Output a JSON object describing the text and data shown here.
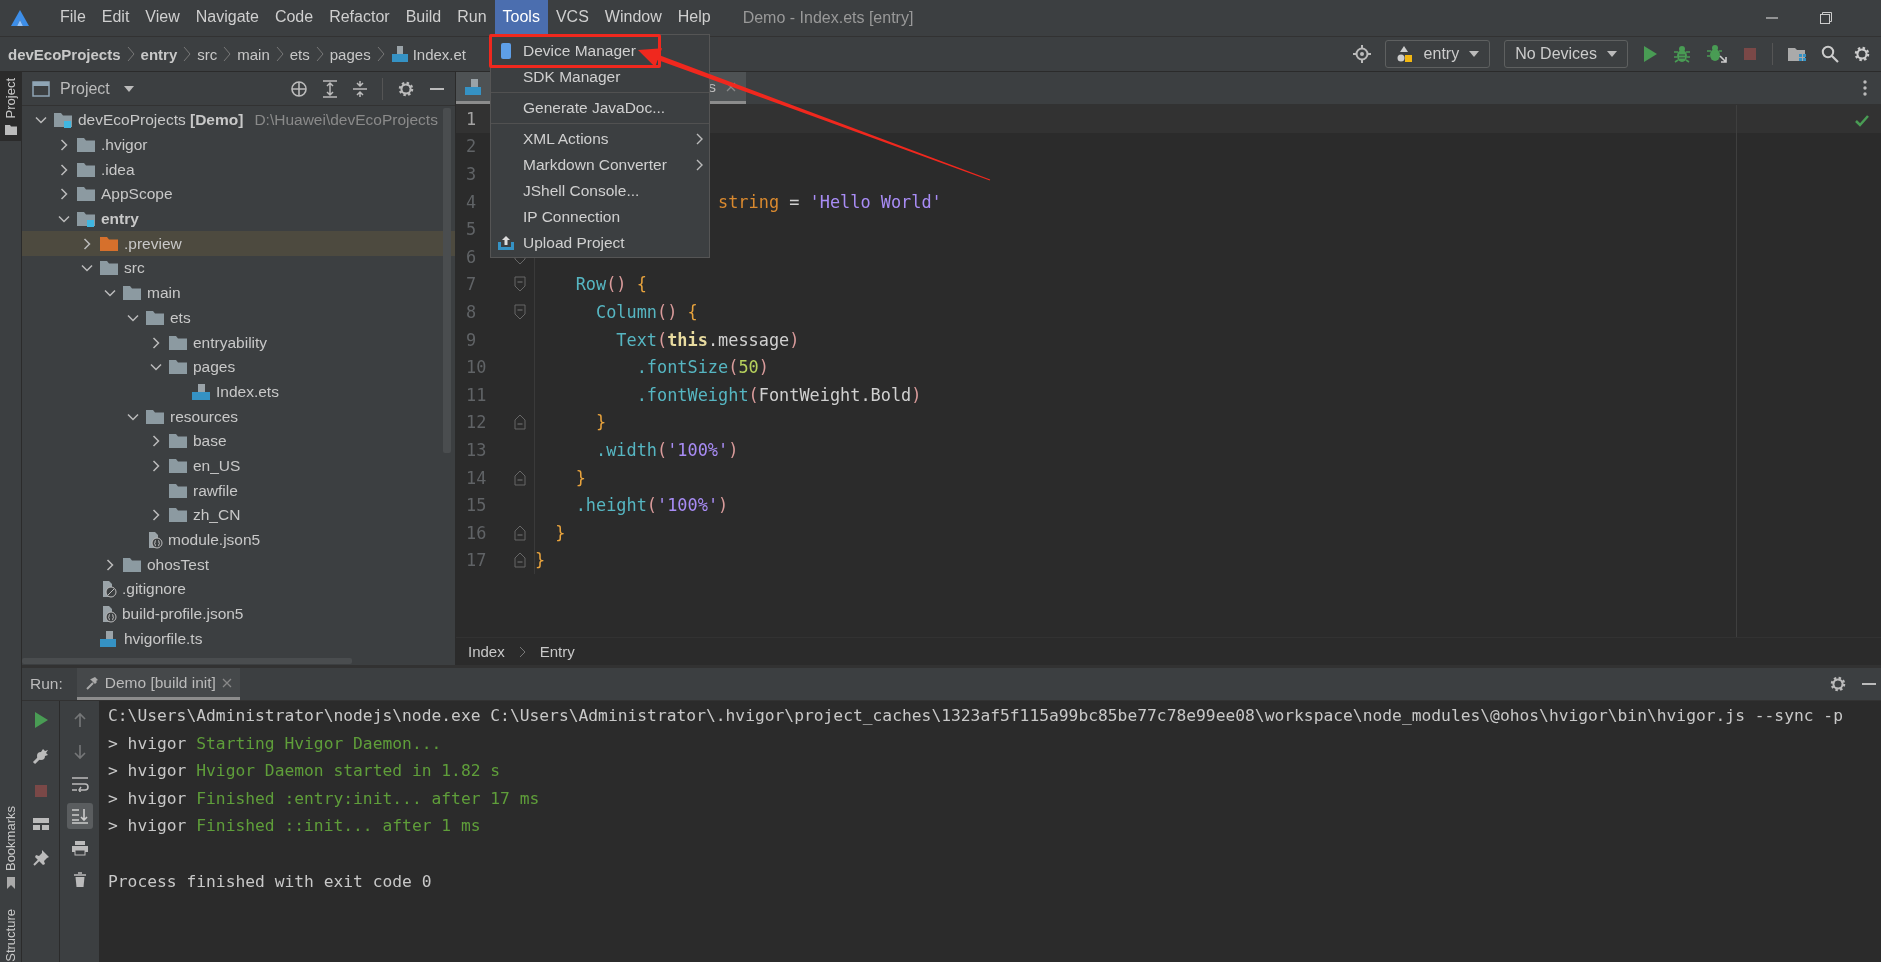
{
  "window": {
    "title": "Demo - Index.ets [entry]"
  },
  "menu_bar": [
    {
      "label": "File",
      "selected": false
    },
    {
      "label": "Edit",
      "selected": false
    },
    {
      "label": "View",
      "selected": false
    },
    {
      "label": "Navigate",
      "selected": false
    },
    {
      "label": "Code",
      "selected": false
    },
    {
      "label": "Refactor",
      "selected": false
    },
    {
      "label": "Build",
      "selected": false
    },
    {
      "label": "Run",
      "selected": false
    },
    {
      "label": "Tools",
      "selected": true
    },
    {
      "label": "VCS",
      "selected": false
    },
    {
      "label": "Window",
      "selected": false
    },
    {
      "label": "Help",
      "selected": false
    }
  ],
  "tools_menu": {
    "items": [
      {
        "kind": "phone-item",
        "label": "Device Manager",
        "annotated": true
      },
      {
        "kind": "item",
        "label": "SDK Manager",
        "annotated": false
      },
      {
        "kind": "separator"
      },
      {
        "kind": "item",
        "label": "Generate JavaDoc...",
        "annotated": false
      },
      {
        "kind": "separator"
      },
      {
        "kind": "submenu",
        "label": "XML Actions",
        "annotated": false
      },
      {
        "kind": "submenu",
        "label": "Markdown Converter",
        "annotated": false
      },
      {
        "kind": "item",
        "label": "JShell Console...",
        "annotated": false
      },
      {
        "kind": "item",
        "label": "IP Connection",
        "annotated": false
      },
      {
        "kind": "upload-item",
        "label": "Upload Project",
        "annotated": false
      }
    ]
  },
  "breadcrumbs": [
    {
      "label": "devEcoProjects",
      "bold": true,
      "kind": "folder"
    },
    {
      "label": "entry",
      "bold": true,
      "kind": "folder"
    },
    {
      "label": "src",
      "bold": false,
      "kind": "folder"
    },
    {
      "label": "main",
      "bold": false,
      "kind": "folder"
    },
    {
      "label": "ets",
      "bold": false,
      "kind": "folder"
    },
    {
      "label": "pages",
      "bold": false,
      "kind": "folder"
    },
    {
      "label": "Index.et",
      "bold": false,
      "kind": "ets-file"
    }
  ],
  "toolbar": {
    "run_config": "entry",
    "device": "No Devices",
    "actions": [
      {
        "kind": "run",
        "disabled": false
      },
      {
        "kind": "debug",
        "disabled": false
      },
      {
        "kind": "attach",
        "disabled": false
      },
      {
        "kind": "stop",
        "disabled": true
      }
    ]
  },
  "side_tabs": [
    {
      "label": "Project",
      "selected": true
    },
    {
      "label": "Bookmarks",
      "selected": false
    },
    {
      "label": "Structure",
      "selected": false
    }
  ],
  "project_panel": {
    "title": "Project",
    "tree": [
      {
        "label": "devEcoProjects **[Demo]**",
        "note": "D:\\Huawei\\devEcoProjects",
        "kind": "module-folder",
        "expanded": true,
        "selected": false,
        "children": [
          {
            "label": ".hvigor",
            "kind": "folder",
            "expanded": false,
            "selected": false
          },
          {
            "label": ".idea",
            "kind": "folder",
            "expanded": false,
            "selected": false
          },
          {
            "label": "AppScope",
            "kind": "folder",
            "expanded": false,
            "selected": false
          },
          {
            "label": "entry",
            "bold": true,
            "kind": "module-folder",
            "expanded": true,
            "selected": false,
            "children": [
              {
                "label": ".preview",
                "kind": "excluded-folder",
                "expanded": false,
                "selected": true
              },
              {
                "label": "src",
                "kind": "folder",
                "expanded": true,
                "selected": false,
                "children": [
                  {
                    "label": "main",
                    "kind": "folder",
                    "expanded": true,
                    "selected": false,
                    "children": [
                      {
                        "label": "ets",
                        "kind": "folder",
                        "expanded": true,
                        "selected": false,
                        "children": [
                          {
                            "label": "entryability",
                            "kind": "folder",
                            "expanded": false,
                            "selected": false
                          },
                          {
                            "label": "pages",
                            "kind": "folder",
                            "expanded": true,
                            "selected": false,
                            "children": [
                              {
                                "label": "Index.ets",
                                "kind": "ets-file",
                                "selected": false
                              }
                            ]
                          }
                        ]
                      },
                      {
                        "label": "resources",
                        "kind": "folder",
                        "expanded": true,
                        "selected": false,
                        "children": [
                          {
                            "label": "base",
                            "kind": "folder",
                            "expanded": false,
                            "selected": false
                          },
                          {
                            "label": "en_US",
                            "kind": "folder",
                            "expanded": false,
                            "selected": false
                          },
                          {
                            "label": "rawfile",
                            "kind": "folder",
                            "selected": false
                          },
                          {
                            "label": "zh_CN",
                            "kind": "folder",
                            "expanded": false,
                            "selected": false
                          }
                        ]
                      },
                      {
                        "label": "module.json5",
                        "kind": "json-file",
                        "selected": false
                      }
                    ]
                  },
                  {
                    "label": "ohosTest",
                    "kind": "folder",
                    "expanded": false,
                    "selected": false
                  }
                ]
              },
              {
                "label": ".gitignore",
                "kind": "git-file",
                "selected": false
              },
              {
                "label": "build-profile.json5",
                "kind": "json-file",
                "selected": false
              },
              {
                "label": "hvigorfile.ts",
                "kind": "ts-file",
                "selected": false
              }
            ]
          }
        ]
      }
    ]
  },
  "editor": {
    "tab": "s",
    "lines": [
      {
        "number": "1",
        "current": true
      },
      {
        "number": "2",
        "current": false
      },
      {
        "number": "3",
        "current": false
      },
      {
        "number": "4",
        "current": false,
        "tokens": [
          {
            "text": "                  string",
            "kind": "type"
          },
          {
            "text": " = ",
            "kind": "plain"
          },
          {
            "text": "'Hello World'",
            "kind": "str"
          }
        ]
      },
      {
        "number": "5",
        "current": false
      },
      {
        "number": "6",
        "current": false,
        "marker": {
          "kind": "fold-start"
        }
      },
      {
        "number": "7",
        "current": false,
        "marker": {
          "kind": "fold-start"
        },
        "tokens": [
          {
            "text": "    Row",
            "kind": "fn"
          },
          {
            "text": "()",
            "kind": "paren"
          },
          {
            "text": " {",
            "kind": "brace"
          }
        ]
      },
      {
        "number": "8",
        "current": false,
        "marker": {
          "kind": "fold-start"
        },
        "tokens": [
          {
            "text": "      Column",
            "kind": "fn"
          },
          {
            "text": "()",
            "kind": "paren"
          },
          {
            "text": " {",
            "kind": "brace"
          }
        ]
      },
      {
        "number": "9",
        "current": false,
        "tokens": [
          {
            "text": "        Text",
            "kind": "fn"
          },
          {
            "text": "(",
            "kind": "paren"
          },
          {
            "text": "this",
            "kind": "kw"
          },
          {
            "text": ".message",
            "kind": "plain"
          },
          {
            "text": ")",
            "kind": "paren"
          }
        ]
      },
      {
        "number": "10",
        "current": false,
        "tokens": [
          {
            "text": "          .fontSize",
            "kind": "fn"
          },
          {
            "text": "(",
            "kind": "paren"
          },
          {
            "text": "50",
            "kind": "num"
          },
          {
            "text": ")",
            "kind": "paren"
          }
        ]
      },
      {
        "number": "11",
        "current": false,
        "tokens": [
          {
            "text": "          .fontWeight",
            "kind": "fn"
          },
          {
            "text": "(",
            "kind": "paren"
          },
          {
            "text": "FontWeight.Bold",
            "kind": "plain"
          },
          {
            "text": ")",
            "kind": "paren"
          }
        ]
      },
      {
        "number": "12",
        "current": false,
        "marker": {
          "kind": "fold-end"
        },
        "tokens": [
          {
            "text": "      }",
            "kind": "brace"
          }
        ]
      },
      {
        "number": "13",
        "current": false,
        "tokens": [
          {
            "text": "      .width",
            "kind": "fn"
          },
          {
            "text": "(",
            "kind": "paren"
          },
          {
            "text": "'100%'",
            "kind": "str"
          },
          {
            "text": ")",
            "kind": "paren"
          }
        ]
      },
      {
        "number": "14",
        "current": false,
        "marker": {
          "kind": "fold-end"
        },
        "tokens": [
          {
            "text": "    }",
            "kind": "brace"
          }
        ]
      },
      {
        "number": "15",
        "current": false,
        "tokens": [
          {
            "text": "    .height",
            "kind": "fn"
          },
          {
            "text": "(",
            "kind": "paren"
          },
          {
            "text": "'100%'",
            "kind": "str"
          },
          {
            "text": ")",
            "kind": "paren"
          }
        ]
      },
      {
        "number": "16",
        "current": false,
        "marker": {
          "kind": "fold-end"
        },
        "tokens": [
          {
            "text": "  }",
            "kind": "brace"
          }
        ]
      },
      {
        "number": "17",
        "current": false,
        "marker": {
          "kind": "fold-end"
        },
        "tokens": [
          {
            "text": "}",
            "kind": "brace"
          }
        ]
      }
    ],
    "breadcrumbs": [
      "Index",
      "Entry"
    ]
  },
  "run_panel": {
    "label": "Run:",
    "tabs": [
      {
        "label": "Demo [build init]",
        "selected": true
      }
    ],
    "tools": [
      {
        "kind": "rerun",
        "disabled": false
      },
      {
        "kind": "wrench",
        "disabled": false
      },
      {
        "kind": "stop",
        "disabled": true
      },
      {
        "kind": "layout",
        "disabled": false
      },
      {
        "kind": "pin",
        "disabled": false
      }
    ],
    "console_tools": [
      {
        "kind": "up",
        "disabled": true,
        "selected": false
      },
      {
        "kind": "down",
        "disabled": true,
        "selected": false
      },
      {
        "kind": "wrap",
        "disabled": false,
        "selected": false
      },
      {
        "kind": "scroll-end",
        "disabled": false,
        "selected": true
      },
      {
        "kind": "print",
        "disabled": false,
        "selected": false
      },
      {
        "kind": "trash",
        "disabled": false,
        "selected": false
      }
    ],
    "console": [
      {
        "kind": "text",
        "segments": [
          {
            "text": "C:\\Users\\Administrator\\nodejs\\node.exe C:\\Users\\Administrator\\.hvigor\\project_caches\\1323af5f115a99bc85be77c78e99ee08\\workspace\\node_modules\\@ohos\\hvigor\\bin\\hvigor.js --sync -p",
            "kind": "plain"
          }
        ]
      },
      {
        "kind": "text",
        "segments": [
          {
            "text": "> hvigor ",
            "kind": "plain"
          },
          {
            "text": "Starting Hvigor Daemon...",
            "kind": "success"
          }
        ]
      },
      {
        "kind": "text",
        "segments": [
          {
            "text": "> hvigor ",
            "kind": "plain"
          },
          {
            "text": "Hvigor Daemon started in 1.82 s",
            "kind": "success"
          }
        ]
      },
      {
        "kind": "text",
        "segments": [
          {
            "text": "> hvigor ",
            "kind": "plain"
          },
          {
            "text": "Finished :entry:init... after 17 ms",
            "kind": "success"
          }
        ]
      },
      {
        "kind": "text",
        "segments": [
          {
            "text": "> hvigor ",
            "kind": "plain"
          },
          {
            "text": "Finished ::init... after 1 ms",
            "kind": "success"
          }
        ]
      },
      {
        "kind": "blank"
      },
      {
        "kind": "text",
        "segments": [
          {
            "text": "Process finished with exit code 0",
            "kind": "plain"
          }
        ]
      }
    ]
  }
}
